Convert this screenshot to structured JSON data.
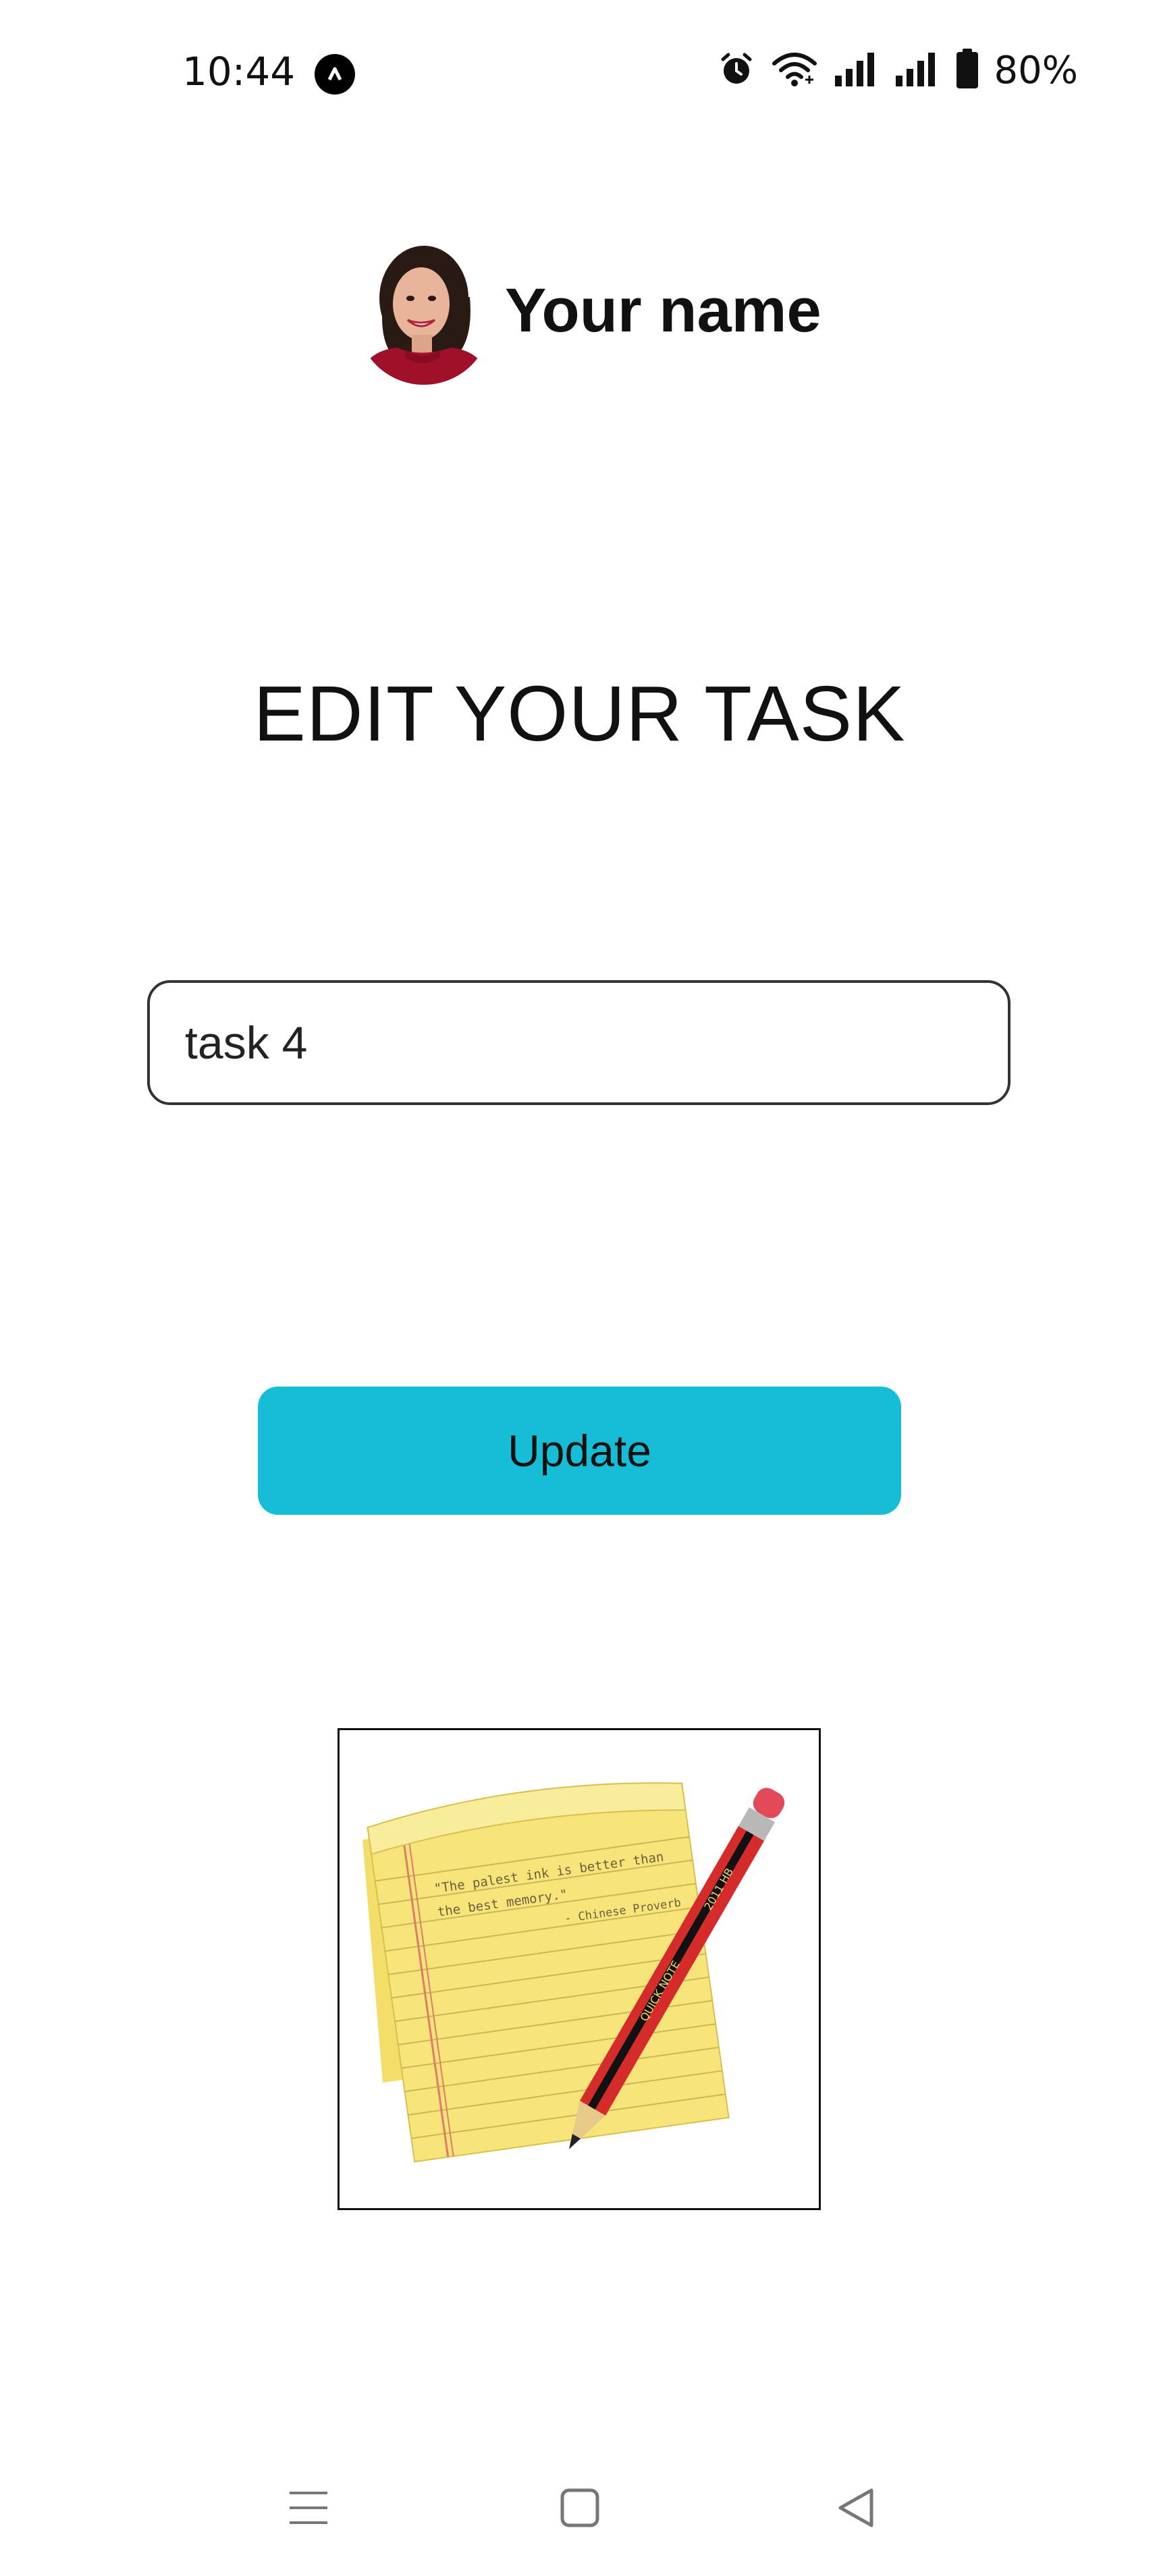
{
  "status_bar": {
    "time": "10:44",
    "battery": "80%",
    "icons": [
      "app-badge-icon",
      "alarm-icon",
      "wifi-icon",
      "signal-icon",
      "signal-icon",
      "battery-icon"
    ]
  },
  "header": {
    "user_name": "Your name",
    "avatar": "avatar-photo"
  },
  "page": {
    "title": "EDIT YOUR TASK"
  },
  "task_input": {
    "value": "task 4"
  },
  "actions": {
    "update_label": "Update"
  },
  "illustration": {
    "quote_line1": "\"The palest ink is better than",
    "quote_line2": "the best memory.\"",
    "quote_attr": "- Chinese Proverb",
    "pencil_brand": "QUICK NOTE",
    "pencil_grade": "2011 HB"
  },
  "nav": {
    "icons": [
      "menu-icon",
      "home-icon",
      "back-icon"
    ]
  },
  "colors": {
    "accent": "#15bdd7",
    "text": "#111111",
    "paper": "#f7e57a",
    "pencil": "#d62b2b"
  }
}
